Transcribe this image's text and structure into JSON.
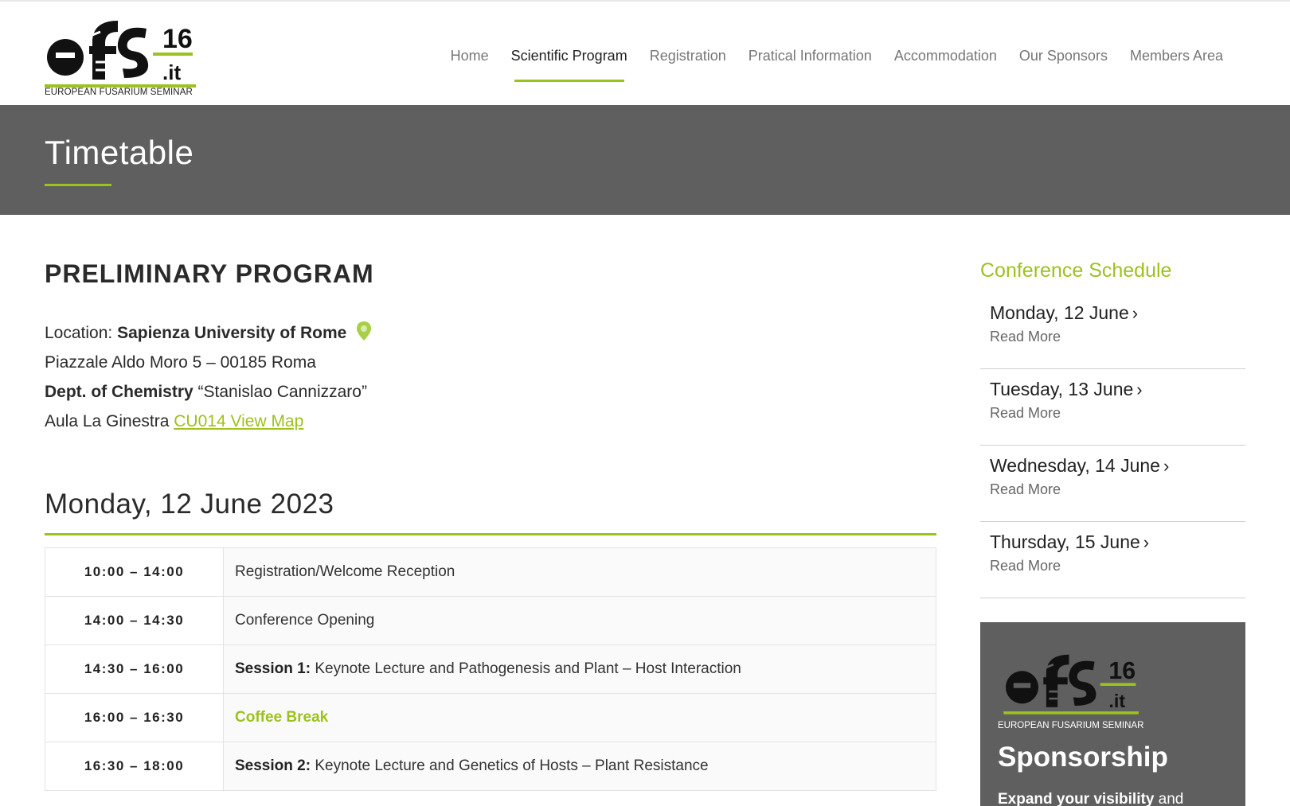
{
  "header": {
    "logo_caption": "EUROPEAN FUSARIUM SEMINAR",
    "logo_number": "16",
    "logo_suffix": ".it",
    "nav": [
      {
        "label": "Home",
        "active": false
      },
      {
        "label": "Scientific Program",
        "active": true
      },
      {
        "label": "Registration",
        "active": false
      },
      {
        "label": "Pratical Information",
        "active": false
      },
      {
        "label": "Accommodation",
        "active": false
      },
      {
        "label": "Our Sponsors",
        "active": false
      },
      {
        "label": "Members Area",
        "active": false
      }
    ]
  },
  "band": {
    "title": "Timetable"
  },
  "main": {
    "program_title": "PRELIMINARY PROGRAM",
    "location_label": "Location: ",
    "location_name": "Sapienza University of Rome",
    "address": "Piazzale Aldo Moro 5 – 00185 Roma",
    "dept_bold": "Dept. of Chemistry",
    "dept_rest": " “Stanislao Cannizzaro”",
    "room_text": "Aula La Ginestra ",
    "map_link": "CU014 View Map",
    "day_title": "Monday, 12 June 2023",
    "rows": [
      {
        "time": "10:00 – 14:00",
        "bold": "",
        "text": "Registration/Welcome Reception",
        "highlight": ""
      },
      {
        "time": "14:00 – 14:30",
        "bold": "",
        "text": "Conference Opening",
        "highlight": ""
      },
      {
        "time": "14:30 – 16:00",
        "bold": "Session 1:",
        "text": " Keynote Lecture and Pathogenesis and Plant – Host Interaction",
        "highlight": ""
      },
      {
        "time": "16:00 – 16:30",
        "bold": "",
        "text": "",
        "highlight": "Coffee Break"
      },
      {
        "time": "16:30 – 18:00",
        "bold": "Session 2:",
        "text": " Keynote Lecture and Genetics of Hosts – Plant Resistance",
        "highlight": ""
      }
    ]
  },
  "sidebar": {
    "title": "Conference Schedule",
    "items": [
      {
        "day": "Monday, 12 June",
        "more": "Read More"
      },
      {
        "day": "Tuesday, 13 June",
        "more": "Read More"
      },
      {
        "day": "Wednesday, 14 June",
        "more": "Read More"
      },
      {
        "day": "Thursday, 15 June",
        "more": "Read More"
      }
    ],
    "sponsor": {
      "caption": "EUROPEAN FUSARIUM SEMINAR",
      "heading": "Sponsorship",
      "text_bold": "Expand your visibility",
      "text_rest": " and"
    }
  },
  "colors": {
    "accent": "#9cc21e",
    "band": "#5f5f5f",
    "text": "#2b2b2b"
  }
}
